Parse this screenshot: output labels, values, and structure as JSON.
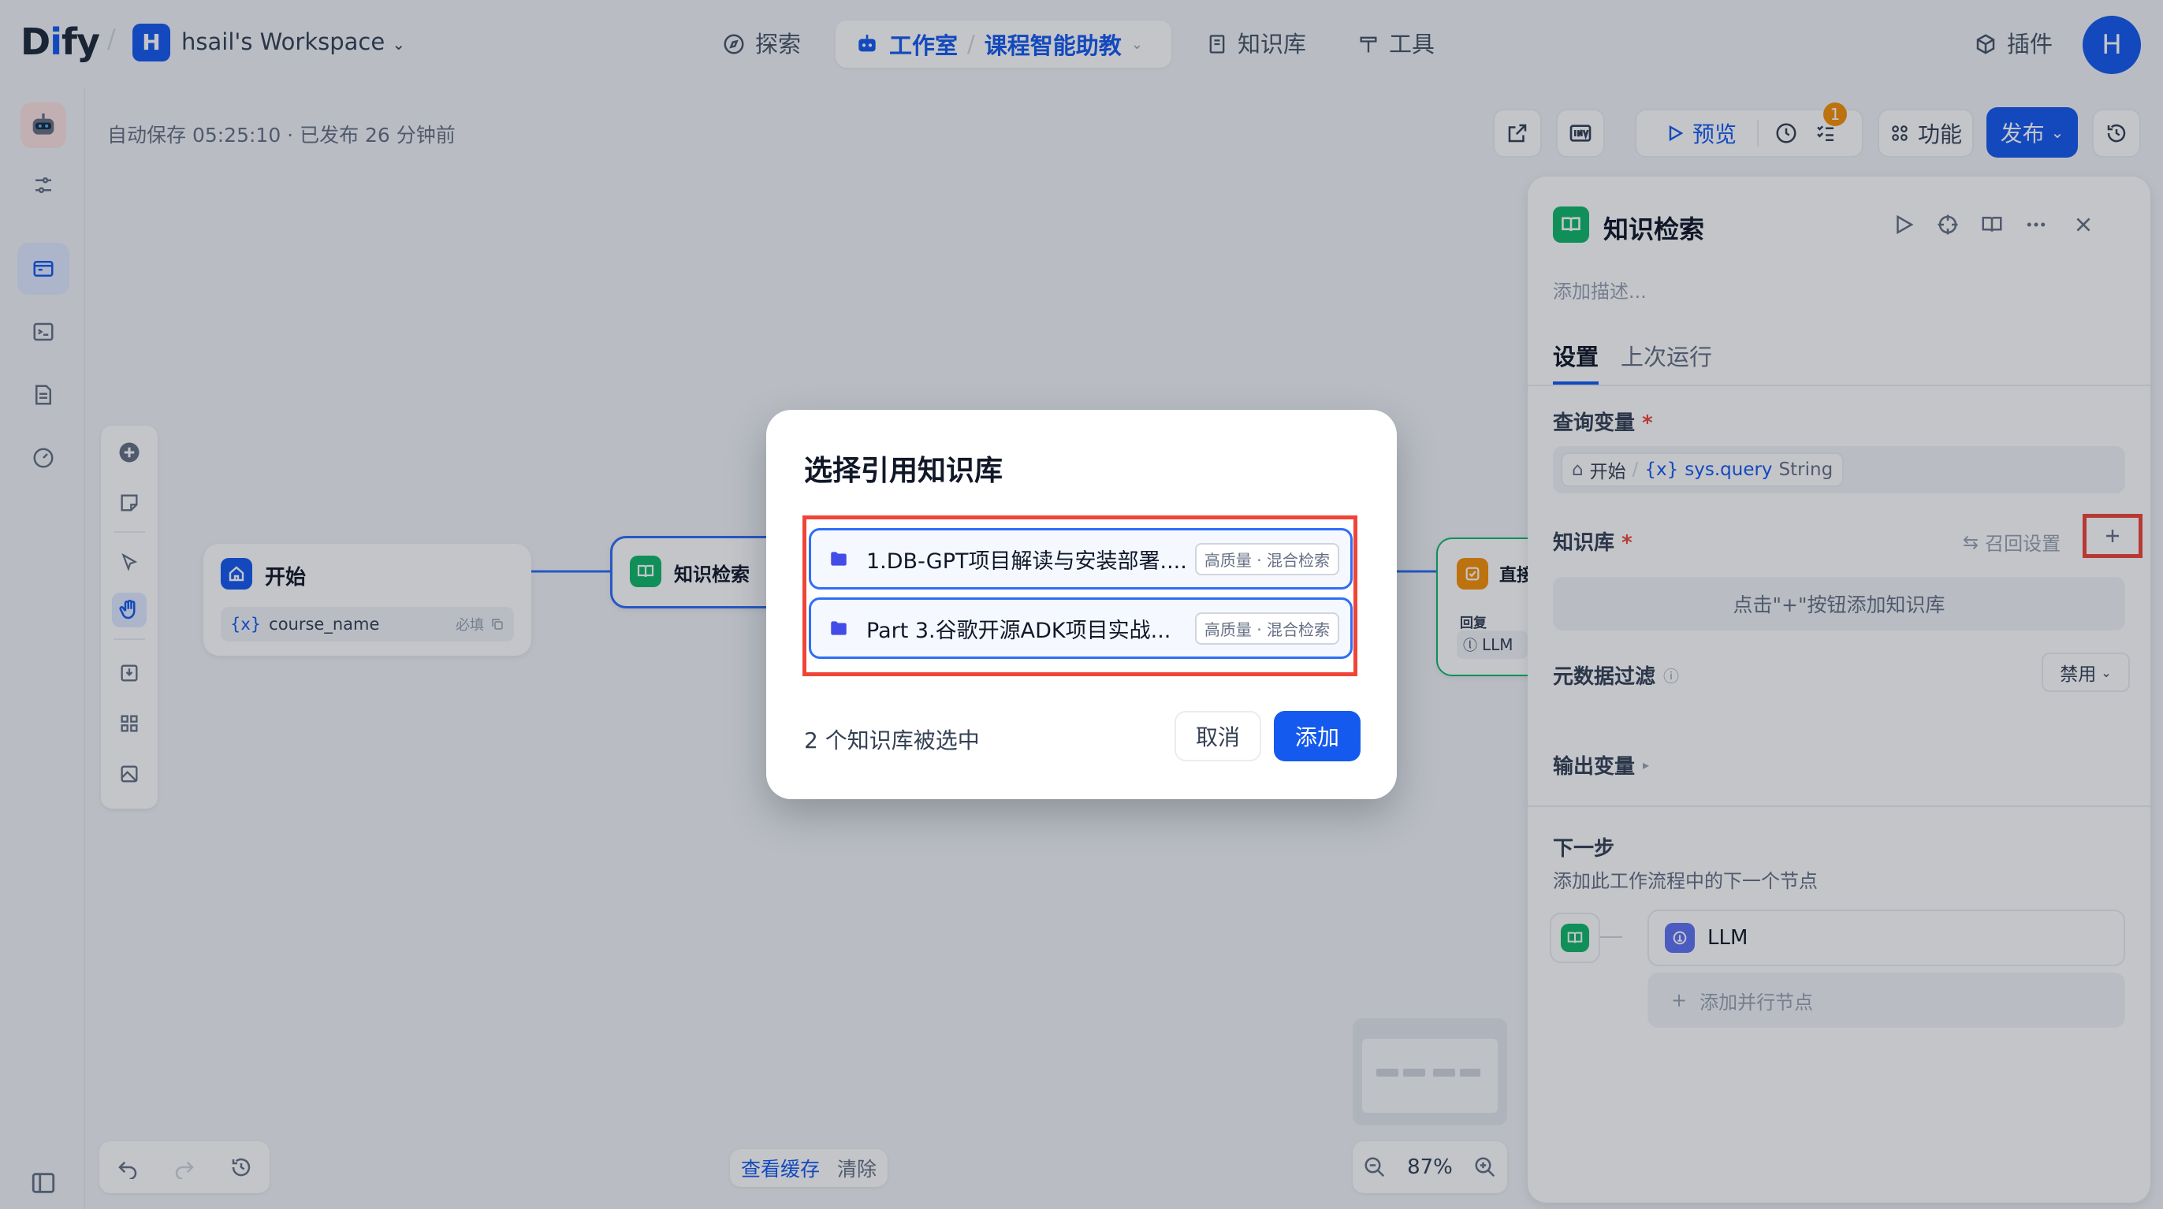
{
  "topbar": {
    "logo": "Dify",
    "workspace_initial": "H",
    "workspace_name": "hsail's Workspace",
    "nav_explore": "探索",
    "nav_studio": "工作室",
    "nav_app": "课程智能助教",
    "nav_knowledge": "知识库",
    "nav_tools": "工具",
    "nav_plugins": "插件",
    "user_initial": "H"
  },
  "canvas": {
    "autosave": "自动保存 05:25:10 · 已发布 26 分钟前",
    "toolbar": {
      "preview": "预览",
      "features": "功能",
      "publish": "发布",
      "checklist_badge": "1"
    },
    "nodes": {
      "start_title": "开始",
      "start_var": "course_name",
      "start_required": "必填",
      "kr_title": "知识检索",
      "answer_title": "直接",
      "answer_sub": "回复",
      "answer_llm": "LLM"
    },
    "bottom": {
      "view_cache": "查看缓存",
      "clear": "清除",
      "zoom": "87%"
    }
  },
  "panel": {
    "title": "知识检索",
    "description_placeholder": "添加描述...",
    "tab_settings": "设置",
    "tab_last_run": "上次运行",
    "query_var_label": "查询变量",
    "query_var_node": "开始",
    "query_var_name": "sys.query",
    "query_var_type": "String",
    "kb_label": "知识库",
    "recall_settings": "召回设置",
    "kb_empty_hint": "点击\"+\"按钮添加知识库",
    "metadata_filter_label": "元数据过滤",
    "metadata_filter_value": "禁用",
    "output_var_label": "输出变量",
    "next_step_label": "下一步",
    "next_step_desc": "添加此工作流程中的下一个节点",
    "next_node": "LLM",
    "add_parallel": "添加并行节点"
  },
  "modal": {
    "title": "选择引用知识库",
    "items": [
      {
        "name": "1.DB-GPT项目解读与安装部署....",
        "tag": "高质量 · 混合检索"
      },
      {
        "name": "Part 3.谷歌开源ADK项目实战...",
        "tag": "高质量 · 混合检索"
      }
    ],
    "selected_count": "2 个知识库被选中",
    "cancel": "取消",
    "add": "添加"
  },
  "colors": {
    "primary": "#155aef",
    "highlight": "#f04438",
    "kr_node": "#12b76a",
    "answer_node": "#f79009"
  }
}
